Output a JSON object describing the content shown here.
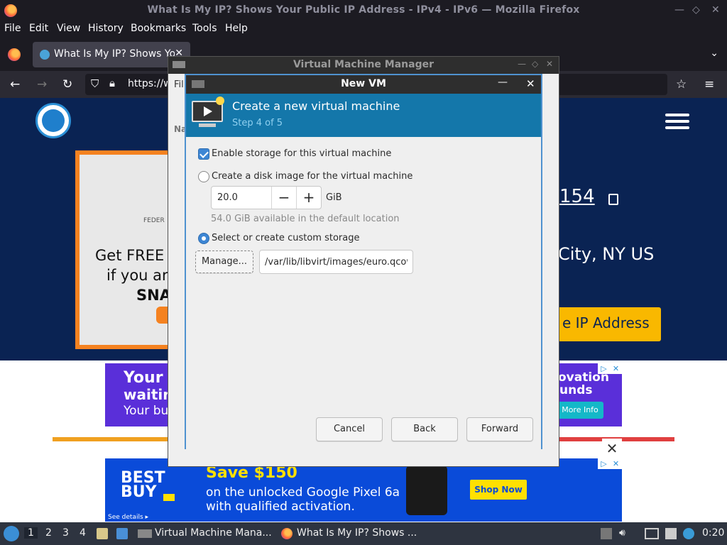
{
  "firefox": {
    "window_title": "What Is My IP? Shows Your Public IP Address - IPv4 - IPv6 — Mozilla Firefox",
    "menu": [
      "File",
      "Edit",
      "View",
      "History",
      "Bookmarks",
      "Tools",
      "Help"
    ],
    "tab_title": "What Is My IP? Shows Yo",
    "url": "https://w"
  },
  "site": {
    "ad_federal": "FEDER",
    "ad_line1": "Get FREE",
    "ad_line2": "if you ar",
    "ad_line3": "SNA",
    "ip_partial": "154",
    "city_partial": "City, NY US",
    "ip_button": "e IP Address",
    "banner1_left": [
      "Your p",
      "waitir",
      "Your bu"
    ],
    "banner1_right": [
      "ovation",
      "unds"
    ],
    "banner1_more": "More Info",
    "bestbuy_logo": [
      "BEST",
      "BUY"
    ],
    "bestbuy_save": "Save $150",
    "bestbuy_l2": "on the unlocked Google Pixel 6a",
    "bestbuy_l3": "with qualified activation.",
    "bestbuy_shop": "Shop Now",
    "bestbuy_details": "See details ▸"
  },
  "vmm": {
    "title": "Virtual Machine Manager",
    "file_partial": "Fil",
    "name_partial": "Na"
  },
  "dialog": {
    "title": "New VM",
    "header_title": "Create a new virtual machine",
    "step": "Step 4 of 5",
    "enable_storage": {
      "label": "Enable storage for this virtual machine",
      "checked": true
    },
    "create_disk": {
      "label": "Create a disk image for the virtual machine",
      "selected": false
    },
    "disk_size": "20.0",
    "disk_unit": "GiB",
    "available": "54.0 GiB available in the default location",
    "custom_storage": {
      "label": "Select or create custom storage",
      "selected": true
    },
    "manage_label": "Manage...",
    "storage_path": "/var/lib/libvirt/images/euro.qcow2",
    "buttons": {
      "cancel": "Cancel",
      "back": "Back",
      "forward": "Forward"
    }
  },
  "taskbar": {
    "workspaces": [
      "1",
      "2",
      "3",
      "4"
    ],
    "tasks": [
      "Virtual Machine Mana...",
      "What Is My IP? Shows ..."
    ],
    "clock": "0:20"
  }
}
